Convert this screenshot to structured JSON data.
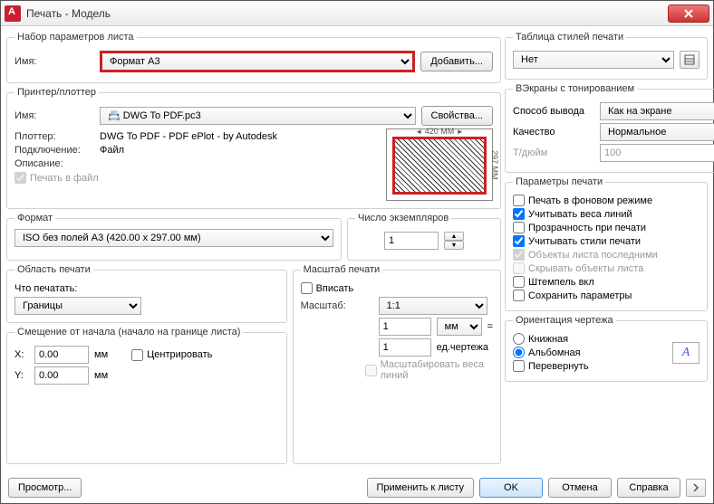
{
  "titlebar": {
    "title": "Печать - Модель"
  },
  "pageSetup": {
    "legend": "Набор параметров листа",
    "name_label": "Имя:",
    "name_value": "Формат А3",
    "add_btn": "Добавить..."
  },
  "printer": {
    "legend": "Принтер/плоттер",
    "name_label": "Имя:",
    "name_value": "📇 DWG To PDF.pc3",
    "props_btn": "Свойства...",
    "plotter_label": "Плоттер:",
    "plotter_value": "DWG To PDF - PDF ePlot - by Autodesk",
    "conn_label": "Подключение:",
    "conn_value": "Файл",
    "desc_label": "Описание:",
    "to_file": "Печать в файл",
    "preview_top": "420 MM",
    "preview_right": "297 MM"
  },
  "paper": {
    "legend": "Формат",
    "value": "ISO без полей A3 (420.00 x 297.00 мм)"
  },
  "copies": {
    "legend": "Число экземпляров",
    "value": "1"
  },
  "area": {
    "legend": "Область печати",
    "what_label": "Что печатать:",
    "what_value": "Границы"
  },
  "scale": {
    "legend": "Масштаб печати",
    "fit": "Вписать",
    "scale_label": "Масштаб:",
    "scale_value": "1:1",
    "unit_value": "1",
    "unit_sel": "мм",
    "unit2_value": "1",
    "unit2_label": "ед.чертежа",
    "lineweights": "Масштабировать веса линий"
  },
  "offset": {
    "legend": "Смещение от начала (начало на границе листа)",
    "x_label": "X:",
    "x_value": "0.00",
    "x_unit": "мм",
    "y_label": "Y:",
    "y_value": "0.00",
    "y_unit": "мм",
    "center": "Центрировать"
  },
  "styles": {
    "legend": "Таблица стилей печати",
    "value": "Нет"
  },
  "shade": {
    "legend": "ВЭкраны с тонированием",
    "method_label": "Способ вывода",
    "method_value": "Как на экране",
    "quality_label": "Качество",
    "quality_value": "Нормальное",
    "dpi_label": "Т/дюйм",
    "dpi_value": "100"
  },
  "options": {
    "legend": "Параметры печати",
    "bg": "Печать в фоновом режиме",
    "lw": "Учитывать веса линий",
    "transp": "Прозрачность при печати",
    "ps": "Учитывать стили печати",
    "paperlast": "Объекты листа последними",
    "hide": "Скрывать объекты листа",
    "stamp": "Штемпель вкл",
    "save": "Сохранить параметры"
  },
  "orient": {
    "legend": "Ориентация чертежа",
    "portrait": "Книжная",
    "landscape": "Альбомная",
    "upside": "Перевернуть"
  },
  "footer": {
    "preview": "Просмотр...",
    "apply": "Применить к листу",
    "ok": "OK",
    "cancel": "Отмена",
    "help": "Справка"
  }
}
